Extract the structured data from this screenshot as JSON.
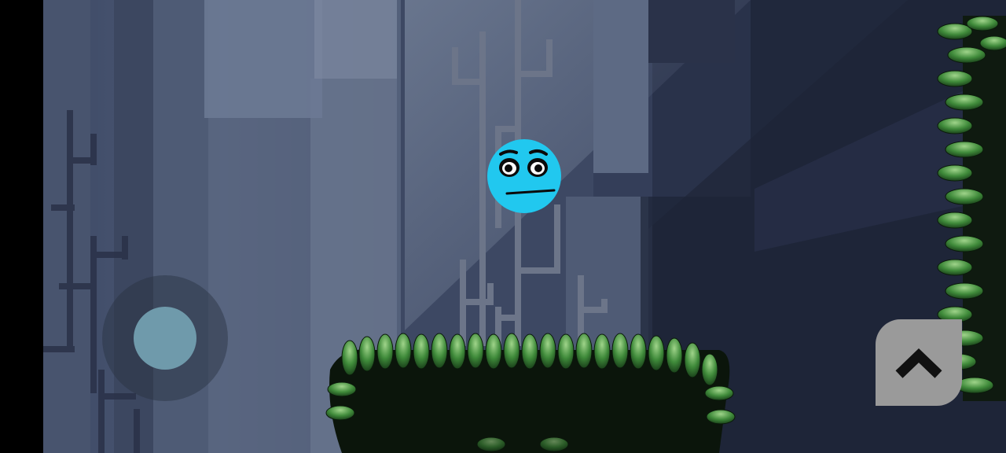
{
  "game": {
    "colors": {
      "player": "#21c8ef",
      "background_dark": "#22293d",
      "fog_light": "#6b7890",
      "foliage_green": "#3f8a3a",
      "joystick_knob": "#6f9aab",
      "jump_button": "#9a9a9a"
    },
    "controls": {
      "joystick": {
        "icon": "joystick-knob"
      },
      "jump_button": {
        "icon": "chevron-up-icon"
      }
    },
    "player": {
      "icon": "blue-ball-face"
    }
  }
}
